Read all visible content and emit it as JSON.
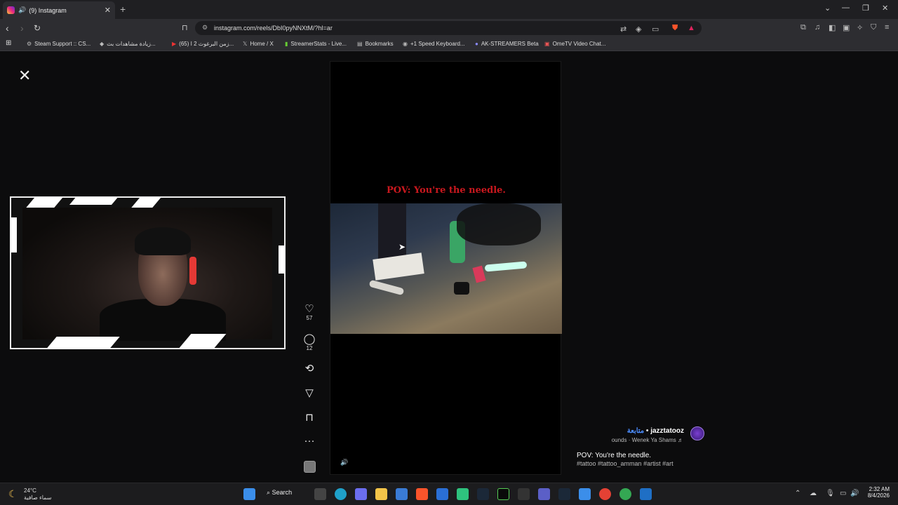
{
  "browser": {
    "tab_title": "(9) Instagram",
    "tab_close": "✕",
    "new_tab": "+",
    "url": "instagram.com/reels/DbI0pyNNXtM/?hl=ar",
    "bookmarks": [
      {
        "label": "Steam Support :: CS..."
      },
      {
        "label": "زيادة مشاهدات بث..."
      },
      {
        "label": "(65) زمن البرغوث 2 ا..."
      },
      {
        "label": "Home / X"
      },
      {
        "label": "StreamerStats - Live..."
      },
      {
        "label": "Bookmarks"
      },
      {
        "label": "+1 Speed Keyboard..."
      },
      {
        "label": "AK-STREAMERS Beta"
      },
      {
        "label": "OmeTV Video Chat..."
      }
    ]
  },
  "reel": {
    "overlay_text": "POV: You're the needle.",
    "likes": "57",
    "comments": "12",
    "author": "jazztatooz",
    "follow": "متابعة",
    "audio": "ounds · Wenek Ya Shams",
    "caption": "POV: You're the needle.",
    "hashtags": "#tattoo #tattoo_amman #artist #art"
  },
  "taskbar": {
    "temperature": "24°C",
    "weather_desc": "سماء صافية",
    "search_label": "Search",
    "time": "2:32 AM",
    "date": "8/4/2026"
  }
}
